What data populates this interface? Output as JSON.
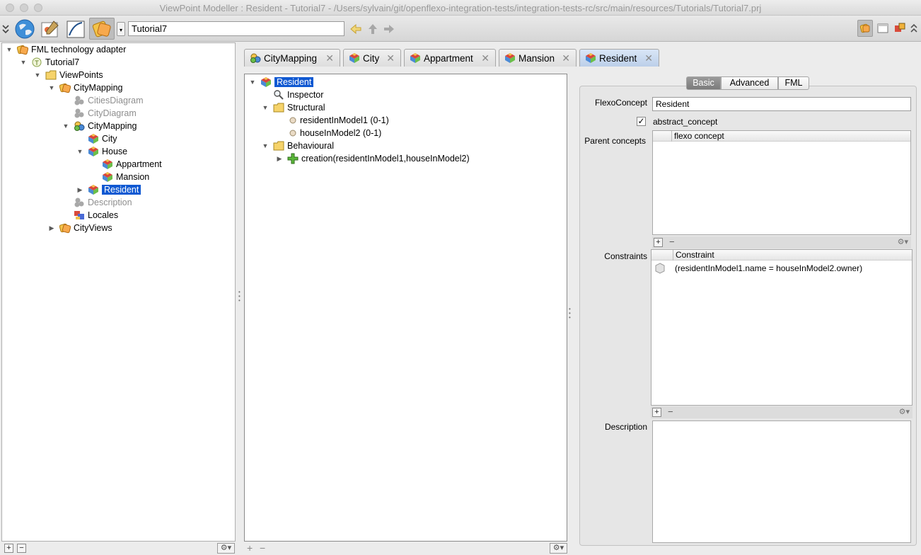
{
  "window": {
    "title": "ViewPoint Modeller : Resident - Tutorial7 - /Users/sylvain/git/openflexo-integration-tests/integration-tests-rc/src/main/resources/Tutorials/Tutorial7.prj"
  },
  "toolbar": {
    "project": "Tutorial7",
    "icons": [
      "collapse-icon",
      "globe-icon",
      "diagram-icon",
      "draw-icon",
      "viewpoint-icon"
    ]
  },
  "left_tree": {
    "items": [
      {
        "label": "FML technology adapter",
        "icon": "viewpoint-icon"
      },
      {
        "label": "Tutorial7",
        "icon": "project-icon"
      },
      {
        "label": "ViewPoints",
        "icon": "folder-icon"
      },
      {
        "label": "CityMapping",
        "icon": "viewpoint-icon"
      },
      {
        "label": "CitiesDiagram",
        "icon": "cluster-icon"
      },
      {
        "label": "CityDiagram",
        "icon": "cluster-icon"
      },
      {
        "label": "CityMapping",
        "icon": "virtual-model-icon"
      },
      {
        "label": "City",
        "icon": "concept-icon"
      },
      {
        "label": "House",
        "icon": "concept-icon"
      },
      {
        "label": "Appartment",
        "icon": "concept-icon"
      },
      {
        "label": "Mansion",
        "icon": "concept-icon"
      },
      {
        "label": "Resident",
        "icon": "concept-icon"
      },
      {
        "label": "Description",
        "icon": "cluster-icon"
      },
      {
        "label": "Locales",
        "icon": "locales-icon"
      },
      {
        "label": "CityViews",
        "icon": "viewpoint-icon"
      }
    ]
  },
  "tabs": [
    {
      "label": "CityMapping"
    },
    {
      "label": "City"
    },
    {
      "label": "Appartment"
    },
    {
      "label": "Mansion"
    },
    {
      "label": "Resident"
    }
  ],
  "concept_tree": {
    "root": "Resident",
    "inspector": "Inspector",
    "structural": "Structural",
    "roles": [
      "residentInModel1 (0-1)",
      "houseInModel2 (0-1)"
    ],
    "behavioural": "Behavioural",
    "behaviours": [
      "creation(residentInModel1,houseInModel2)"
    ]
  },
  "inspector": {
    "tabs": [
      "Basic",
      "Advanced",
      "FML"
    ],
    "active_tab": "Basic",
    "flexo_concept_label": "FlexoConcept",
    "flexo_concept_value": "Resident",
    "abstract_label": "abstract_concept",
    "abstract_checked": true,
    "parent_concepts_label": "Parent concepts",
    "parent_column": "flexo concept",
    "constraints_label": "Constraints",
    "constraint_column": "Constraint",
    "constraints": [
      "(residentInModel1.name = houseInModel2.owner)"
    ],
    "description_label": "Description",
    "description_value": ""
  },
  "colors": {
    "selection": "#1059d2",
    "active_tab": "#c8d8ef"
  }
}
